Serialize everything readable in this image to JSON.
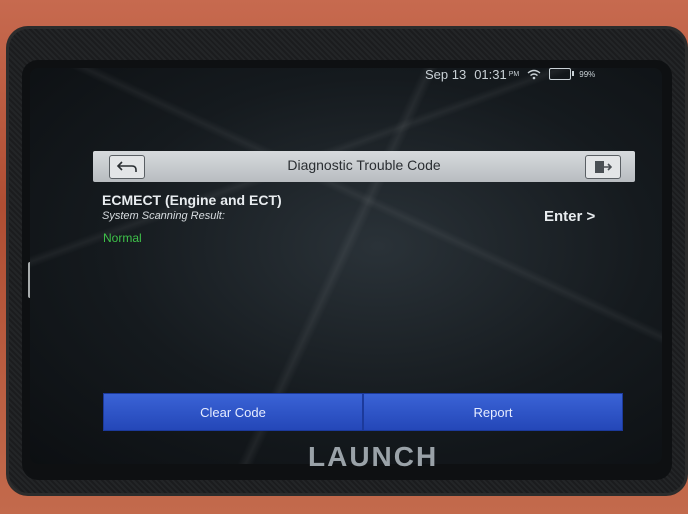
{
  "status_bar": {
    "date": "Sep 13",
    "time": "01:31",
    "ampm": "PM",
    "battery": "99%"
  },
  "header": {
    "title": "Diagnostic Trouble Code",
    "back_icon": "back-arrow-icon",
    "exit_icon": "exit-icon"
  },
  "result": {
    "system_name": "ECMECT (Engine and ECT)",
    "scan_label": "System Scanning Result:",
    "status": "Normal",
    "enter_label": "Enter >"
  },
  "footer": {
    "clear_code_label": "Clear Code",
    "report_label": "Report"
  },
  "device": {
    "brand": "LAUNCH"
  },
  "colors": {
    "accent_blue": "#2447b8",
    "status_green": "#3fc24a"
  }
}
